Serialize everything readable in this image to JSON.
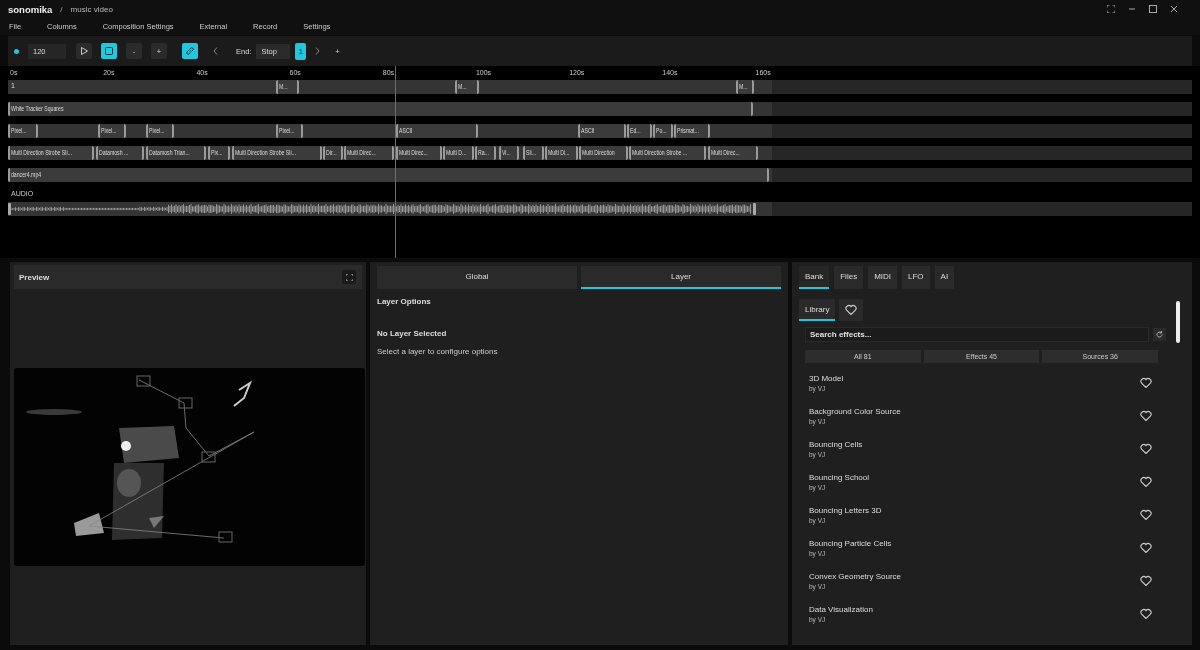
{
  "window": {
    "logo": "sonomika",
    "separator": "/",
    "title": "music video"
  },
  "menu": [
    "File",
    "Columns",
    "Composition Settings",
    "External",
    "Record",
    "Settings"
  ],
  "toolbar": {
    "bpm": "120",
    "play_selected": false,
    "stop_selected": true,
    "zoom_out": "-",
    "zoom_in": "+",
    "link_selected": true,
    "end_label": "End:",
    "end_value": "Stop",
    "page": "1",
    "add": "+"
  },
  "timeline": {
    "ticks": [
      "0s",
      "20s",
      "40s",
      "60s",
      "80s",
      "100s",
      "120s",
      "140s",
      "160s"
    ],
    "tracks": [
      {
        "label": "1",
        "clips": [
          {
            "name": "M..."
          },
          {
            "name": "M..."
          },
          {
            "name": "M..."
          }
        ]
      },
      {
        "clips": [
          {
            "name": "White Tracker Squares"
          }
        ]
      },
      {
        "clips": [
          {
            "name": "Pixel..."
          },
          {
            "name": "Pixel..."
          },
          {
            "name": "Pixel..."
          },
          {
            "name": "Pixel..."
          },
          {
            "name": "ASCII"
          },
          {
            "name": "ASCII"
          },
          {
            "name": "Ed..."
          },
          {
            "name": "Po..."
          },
          {
            "name": "Prismat..."
          }
        ]
      },
      {
        "clips": [
          {
            "name": "Multi Direction Strobe Sli..."
          },
          {
            "name": "Datamosh ..."
          },
          {
            "name": "Datamosh Trian..."
          },
          {
            "name": "Pix..."
          },
          {
            "name": "Multi Direction Strobe Sli..."
          },
          {
            "name": "Dir..."
          },
          {
            "name": "Multi Direc..."
          },
          {
            "name": "Multi Direc..."
          },
          {
            "name": "Multi D..."
          },
          {
            "name": "Ra..."
          },
          {
            "name": "Vi..."
          },
          {
            "name": "Sli..."
          },
          {
            "name": "Multi Di..."
          },
          {
            "name": "Multi Direction"
          },
          {
            "name": "Multi Direction Strobe ..."
          },
          {
            "name": "Multi Direc..."
          }
        ]
      },
      {
        "clips": [
          {
            "name": "dancer4.mp4"
          }
        ]
      }
    ],
    "audio": {
      "label": "AUDIO"
    }
  },
  "preview": {
    "title": "Preview"
  },
  "layer_panel": {
    "tabs": [
      {
        "label": "Global",
        "selected": false
      },
      {
        "label": "Layer",
        "selected": true
      }
    ],
    "heading": "Layer Options",
    "status": "No Layer Selected",
    "hint": "Select a layer to configure options"
  },
  "bank": {
    "tabs": [
      {
        "label": "Bank",
        "selected": true
      },
      {
        "label": "Files",
        "selected": false
      },
      {
        "label": "MIDI",
        "selected": false
      },
      {
        "label": "LFO",
        "selected": false
      },
      {
        "label": "AI",
        "selected": false
      }
    ],
    "subtabs": [
      {
        "kind": "text",
        "label": "Library",
        "selected": true
      },
      {
        "kind": "favorites",
        "selected": false
      }
    ],
    "search": {
      "placeholder": "Search effects..."
    },
    "filters": [
      {
        "label": "All 81"
      },
      {
        "label": "Effects 45"
      },
      {
        "label": "Sources 36"
      }
    ],
    "items": [
      {
        "name": "3D Model",
        "author": "by VJ",
        "favorite": false
      },
      {
        "name": "Background Color Source",
        "author": "by VJ",
        "favorite": false
      },
      {
        "name": "Bouncing Cells",
        "author": "by VJ",
        "favorite": false
      },
      {
        "name": "Bouncing School",
        "author": "by VJ",
        "favorite": false
      },
      {
        "name": "Bouncing Letters 3D",
        "author": "by VJ",
        "favorite": false
      },
      {
        "name": "Bouncing Particle Cells",
        "author": "by VJ",
        "favorite": false
      },
      {
        "name": "Convex Geometry Source",
        "author": "by VJ",
        "favorite": false
      },
      {
        "name": "Data Visualization",
        "author": "by VJ",
        "favorite": false
      }
    ]
  }
}
